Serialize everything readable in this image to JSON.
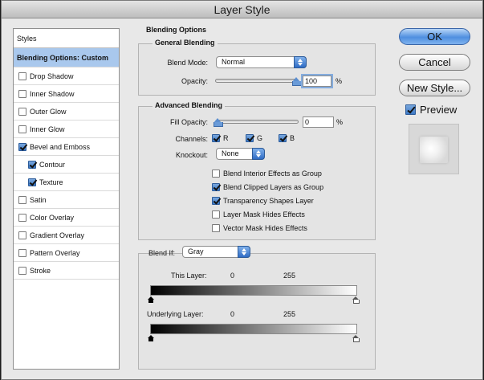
{
  "window": {
    "title": "Layer Style"
  },
  "styles_panel": {
    "header": "Styles",
    "items": [
      {
        "label": "Blending Options: Custom",
        "checkbox": false,
        "checked": false,
        "selected": true,
        "indent": false
      },
      {
        "label": "Drop Shadow",
        "checkbox": true,
        "checked": false,
        "selected": false,
        "indent": false
      },
      {
        "label": "Inner Shadow",
        "checkbox": true,
        "checked": false,
        "selected": false,
        "indent": false
      },
      {
        "label": "Outer Glow",
        "checkbox": true,
        "checked": false,
        "selected": false,
        "indent": false
      },
      {
        "label": "Inner Glow",
        "checkbox": true,
        "checked": false,
        "selected": false,
        "indent": false
      },
      {
        "label": "Bevel and Emboss",
        "checkbox": true,
        "checked": true,
        "selected": false,
        "indent": false
      },
      {
        "label": "Contour",
        "checkbox": true,
        "checked": true,
        "selected": false,
        "indent": true
      },
      {
        "label": "Texture",
        "checkbox": true,
        "checked": true,
        "selected": false,
        "indent": true
      },
      {
        "label": "Satin",
        "checkbox": true,
        "checked": false,
        "selected": false,
        "indent": false
      },
      {
        "label": "Color Overlay",
        "checkbox": true,
        "checked": false,
        "selected": false,
        "indent": false
      },
      {
        "label": "Gradient Overlay",
        "checkbox": true,
        "checked": false,
        "selected": false,
        "indent": false
      },
      {
        "label": "Pattern Overlay",
        "checkbox": true,
        "checked": false,
        "selected": false,
        "indent": false
      },
      {
        "label": "Stroke",
        "checkbox": true,
        "checked": false,
        "selected": false,
        "indent": false
      }
    ]
  },
  "blending_options": {
    "title": "Blending Options",
    "general": {
      "title": "General Blending",
      "blend_mode_label": "Blend Mode:",
      "blend_mode_value": "Normal",
      "opacity_label": "Opacity:",
      "opacity_value": "100",
      "opacity_unit": "%",
      "opacity_fraction": 1.0
    },
    "advanced": {
      "title": "Advanced Blending",
      "fill_opacity_label": "Fill Opacity:",
      "fill_opacity_value": "0",
      "fill_opacity_unit": "%",
      "fill_opacity_fraction": 0.0,
      "channels_label": "Channels:",
      "channel_r": "R",
      "channel_g": "G",
      "channel_b": "B",
      "knockout_label": "Knockout:",
      "knockout_value": "None",
      "options": [
        {
          "label": "Blend Interior Effects as Group",
          "checked": false
        },
        {
          "label": "Blend Clipped Layers as Group",
          "checked": true
        },
        {
          "label": "Transparency Shapes Layer",
          "checked": true
        },
        {
          "label": "Layer Mask Hides Effects",
          "checked": false
        },
        {
          "label": "Vector Mask Hides Effects",
          "checked": false
        }
      ]
    },
    "blend_if": {
      "label": "Blend If:",
      "value": "Gray",
      "this_layer_label": "This Layer:",
      "this_layer_low": "0",
      "this_layer_high": "255",
      "underlying_label": "Underlying Layer:",
      "underlying_low": "0",
      "underlying_high": "255"
    }
  },
  "buttons": {
    "ok": "OK",
    "cancel": "Cancel",
    "new_style": "New Style...",
    "preview": "Preview"
  },
  "colors": {
    "accent": "#3c79c6",
    "selection": "#a9c8ed",
    "window_bg": "#e8e8e8"
  }
}
